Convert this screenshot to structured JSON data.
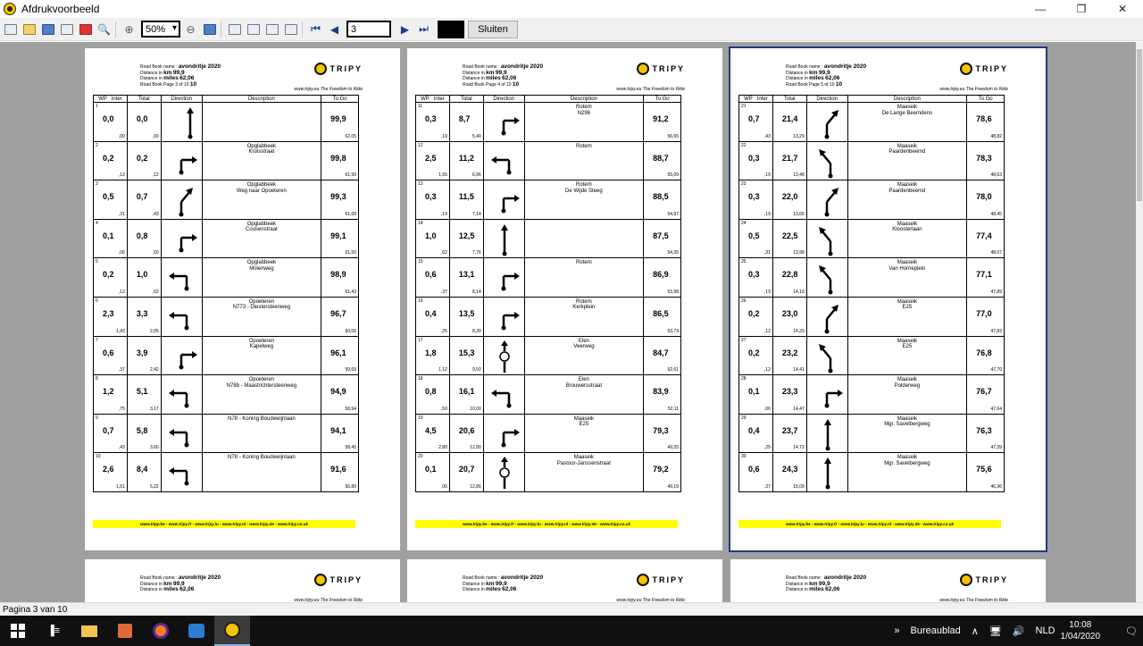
{
  "window": {
    "title": "Afdrukvoorbeeld"
  },
  "toolbar": {
    "zoom": "50%",
    "page_input": "3",
    "close_label": "Sluiten"
  },
  "status": {
    "text": "Pagina 3 van 10"
  },
  "roadbook": {
    "name_label": "Road Book name :",
    "name": "avondritje 2020",
    "km_label": "Distance in",
    "km_unit": "km",
    "km_value": "99,9",
    "miles_unit": "miles",
    "miles_value": "62,06",
    "page_label": "Road Book Page",
    "logo_text": "TRIPY",
    "slogan_site": "www.tripy.eu",
    "slogan": "The Freedom to Ride",
    "footer": "www.tripy.be - www.tripy.fr - www.tripy.lu - www.tripy.nl - www.tripy.de - www.tripy.co.uk",
    "columns": [
      "WP",
      "Inter",
      "Total",
      "Direction",
      "Description",
      "To Go"
    ]
  },
  "pages": [
    {
      "page_no": "3 of 10",
      "page_big": "10",
      "rows": [
        {
          "wp": "1",
          "inter": "0,0",
          "inter_mi": ",00",
          "total": "0,0",
          "total_mi": ",00",
          "desc": "",
          "togo": "99,9",
          "togo_mi": "62,05",
          "dir": "start"
        },
        {
          "wp": "2",
          "inter": "0,2",
          "inter_mi": ",12",
          "total": "0,2",
          "total_mi": ",12",
          "desc": "Opglabbeek\nKruisstraat",
          "togo": "99,8",
          "togo_mi": "61,99",
          "dir": "right"
        },
        {
          "wp": "3",
          "inter": "0,5",
          "inter_mi": ",31",
          "total": "0,7",
          "total_mi": ",43",
          "desc": "Opglabbeek\nWeg naar Opoeteren",
          "togo": "99,3",
          "togo_mi": "61,68",
          "dir": "slight-right"
        },
        {
          "wp": "4",
          "inter": "0,1",
          "inter_mi": ",06",
          "total": "0,8",
          "total_mi": ",50",
          "desc": "Opglabbeek\nCousenstraat",
          "togo": "99,1",
          "togo_mi": "61,55",
          "dir": "right"
        },
        {
          "wp": "5",
          "inter": "0,2",
          "inter_mi": ",12",
          "total": "1,0",
          "total_mi": ",62",
          "desc": "Opglabbeek\nMolenweg",
          "togo": "98,9",
          "togo_mi": "61,43",
          "dir": "left"
        },
        {
          "wp": "6",
          "inter": "2,3",
          "inter_mi": "1,43",
          "total": "3,3",
          "total_mi": "2,05",
          "desc": "Opoeteren\nN773 - Diestersteenweg",
          "togo": "96,7",
          "togo_mi": "60,06",
          "dir": "left"
        },
        {
          "wp": "7",
          "inter": "0,6",
          "inter_mi": ",37",
          "total": "3,9",
          "total_mi": "2,42",
          "desc": "Opoeteren\nKapelweg",
          "togo": "96,1",
          "togo_mi": "59,69",
          "dir": "right"
        },
        {
          "wp": "8",
          "inter": "1,2",
          "inter_mi": ",75",
          "total": "5,1",
          "total_mi": "3,17",
          "desc": "Opoeteren\nN78b - Maastrichtersteenweg",
          "togo": "94,9",
          "togo_mi": "58,94",
          "dir": "left"
        },
        {
          "wp": "9",
          "inter": "0,7",
          "inter_mi": ",43",
          "total": "5,8",
          "total_mi": "3,60",
          "desc": "N78 - Koning Boudewijnlaan",
          "togo": "94,1",
          "togo_mi": "58,45",
          "dir": "left"
        },
        {
          "wp": "10",
          "inter": "2,6",
          "inter_mi": "1,61",
          "total": "8,4",
          "total_mi": "5,22",
          "desc": "N78 - Koning Boudewijnlaan",
          "togo": "91,6",
          "togo_mi": "56,89",
          "dir": "left"
        }
      ]
    },
    {
      "page_no": "4 of 10",
      "page_big": "10",
      "rows": [
        {
          "wp": "11",
          "inter": "0,3",
          "inter_mi": ",19",
          "total": "8,7",
          "total_mi": "5,40",
          "desc": "Rotem\nN296",
          "togo": "91,2",
          "togo_mi": "56,65",
          "dir": "right"
        },
        {
          "wp": "12",
          "inter": "2,5",
          "inter_mi": "1,55",
          "total": "11,2",
          "total_mi": "6,96",
          "desc": "Rotem",
          "togo": "88,7",
          "togo_mi": "55,09",
          "dir": "left"
        },
        {
          "wp": "13",
          "inter": "0,3",
          "inter_mi": ",19",
          "total": "11,5",
          "total_mi": "7,14",
          "desc": "Rotem\nDe Wijde Steeg",
          "togo": "88,5",
          "togo_mi": "54,97",
          "dir": "right"
        },
        {
          "wp": "14",
          "inter": "1,0",
          "inter_mi": ",62",
          "total": "12,5",
          "total_mi": "7,76",
          "desc": "",
          "togo": "87,5",
          "togo_mi": "54,35",
          "dir": "straight"
        },
        {
          "wp": "15",
          "inter": "0,6",
          "inter_mi": ",37",
          "total": "13,1",
          "total_mi": "8,14",
          "desc": "Rotem",
          "togo": "86,9",
          "togo_mi": "53,98",
          "dir": "right"
        },
        {
          "wp": "16",
          "inter": "0,4",
          "inter_mi": ",25",
          "total": "13,5",
          "total_mi": "8,39",
          "desc": "Rotem\nKerkplein",
          "togo": "86,5",
          "togo_mi": "53,73",
          "dir": "right"
        },
        {
          "wp": "17",
          "inter": "1,8",
          "inter_mi": "1,12",
          "total": "15,3",
          "total_mi": "9,50",
          "desc": "Elen\nVeerweg",
          "togo": "84,7",
          "togo_mi": "52,61",
          "dir": "roundabout"
        },
        {
          "wp": "18",
          "inter": "0,8",
          "inter_mi": ",50",
          "total": "16,1",
          "total_mi": "10,00",
          "desc": "Elen\nBrouwersstraat",
          "togo": "83,9",
          "togo_mi": "52,11",
          "dir": "left"
        },
        {
          "wp": "19",
          "inter": "4,5",
          "inter_mi": "2,80",
          "total": "20,6",
          "total_mi": "12,80",
          "desc": "Maaseik\nE25",
          "togo": "79,3",
          "togo_mi": "49,25",
          "dir": "right"
        },
        {
          "wp": "20",
          "inter": "0,1",
          "inter_mi": ",06",
          "total": "20,7",
          "total_mi": "12,86",
          "desc": "Maaseik\nPastoor-Janssenstraat",
          "togo": "79,2",
          "togo_mi": "49,19",
          "dir": "roundabout"
        }
      ]
    },
    {
      "page_no": "5 of 10",
      "page_big": "10",
      "rows": [
        {
          "wp": "21",
          "inter": "0,7",
          "inter_mi": ",43",
          "total": "21,4",
          "total_mi": "13,29",
          "desc": "Maaseik\nDe Lange Beemdens",
          "togo": "78,6",
          "togo_mi": "48,82",
          "dir": "slight-right"
        },
        {
          "wp": "22",
          "inter": "0,3",
          "inter_mi": ",19",
          "total": "21,7",
          "total_mi": "13,48",
          "desc": "Maaseik\nPaardenbeemd",
          "togo": "78,3",
          "togo_mi": "48,63",
          "dir": "slight-left"
        },
        {
          "wp": "23",
          "inter": "0,3",
          "inter_mi": ",19",
          "total": "22,0",
          "total_mi": "13,66",
          "desc": "Maaseik\nPaardenbeemd",
          "togo": "78,0",
          "togo_mi": "48,45",
          "dir": "slight-right"
        },
        {
          "wp": "24",
          "inter": "0,5",
          "inter_mi": ",31",
          "total": "22,5",
          "total_mi": "13,98",
          "desc": "Maaseik\nKloosterlaan",
          "togo": "77,4",
          "togo_mi": "48,07",
          "dir": "slight-left"
        },
        {
          "wp": "25",
          "inter": "0,3",
          "inter_mi": ",19",
          "total": "22,8",
          "total_mi": "14,16",
          "desc": "Maaseik\nVan Horneplein",
          "togo": "77,1",
          "togo_mi": "47,89",
          "dir": "slight-left"
        },
        {
          "wp": "26",
          "inter": "0,2",
          "inter_mi": ",12",
          "total": "23,0",
          "total_mi": "14,29",
          "desc": "Maaseik\nE25",
          "togo": "77,0",
          "togo_mi": "47,83",
          "dir": "slight-right"
        },
        {
          "wp": "27",
          "inter": "0,2",
          "inter_mi": ",12",
          "total": "23,2",
          "total_mi": "14,41",
          "desc": "Maaseik\nE25",
          "togo": "76,8",
          "togo_mi": "47,70",
          "dir": "slight-left"
        },
        {
          "wp": "28",
          "inter": "0,1",
          "inter_mi": ",06",
          "total": "23,3",
          "total_mi": "14,47",
          "desc": "Maaseik\nPolderweg",
          "togo": "76,7",
          "togo_mi": "47,64",
          "dir": "right"
        },
        {
          "wp": "29",
          "inter": "0,4",
          "inter_mi": ",25",
          "total": "23,7",
          "total_mi": "14,72",
          "desc": "Maaseik\nMgr. Savelbergweg",
          "togo": "76,3",
          "togo_mi": "47,39",
          "dir": "straight"
        },
        {
          "wp": "30",
          "inter": "0,6",
          "inter_mi": ",37",
          "total": "24,3",
          "total_mi": "15,09",
          "desc": "Maaseik\nMgr. Savelbergweg",
          "togo": "75,6",
          "togo_mi": "46,96",
          "dir": "straight"
        }
      ]
    }
  ],
  "taskbar": {
    "desktop_label": "Bureaublad",
    "lang": "NLD",
    "time": "10:08",
    "date": "1/04/2020"
  }
}
